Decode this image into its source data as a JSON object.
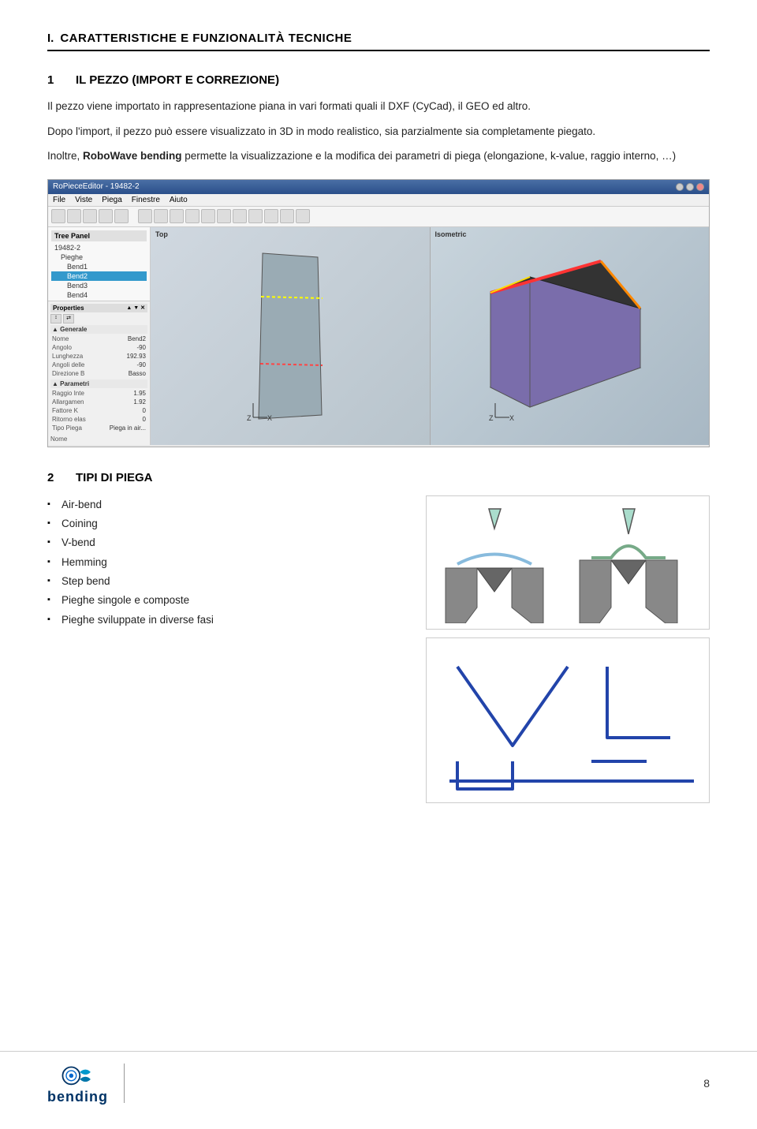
{
  "page": {
    "section_number": "I.",
    "section_title": "CARATTERISTICHE E FUNZIONALITÀ TECNICHE",
    "subsections": [
      {
        "number": "1",
        "title": "IL PEZZO (Import e Correzione)",
        "paragraphs": [
          "Il pezzo viene importato in rappresentazione piana in vari formati quali il DXF (CyCad), il GEO ed altro.",
          "Dopo l'import, il pezzo può essere visualizzato in 3D in modo realistico, sia parzialmente sia completamente piegato.",
          "Inoltre, RoboWave bending permette la visualizzazione e la modifica dei parametri di piega (elongazione, k-value, raggio interno, …)"
        ],
        "paragraph3_bold_start": "RoboWave bending"
      },
      {
        "number": "2",
        "title": "TIPI DI PIEGA",
        "bullets": [
          "Air-bend",
          "Coining",
          "V-bend",
          "Hemming",
          "Step bend",
          "Pieghe singole e composte",
          "Pieghe sviluppate in diverse fasi"
        ]
      }
    ]
  },
  "software": {
    "title": "RoPieceEditor - 19482-2",
    "menus": [
      "File",
      "Viste",
      "Piega",
      "Finestre",
      "Aiuto"
    ],
    "tree_panel_title": "Tree Panel",
    "tree_items": [
      "19482-2",
      "Pieghe",
      "Bend1",
      "Bend2",
      "Bend3",
      "Bend4"
    ],
    "viewport_left_label": "Top",
    "viewport_right_label": "Isometric",
    "properties_title": "Properties",
    "properties_items": [
      {
        "label": "Generale",
        "value": ""
      },
      {
        "label": "Nome",
        "value": "Bend2"
      },
      {
        "label": "Angolo",
        "value": "-90"
      },
      {
        "label": "Lunghezza",
        "value": "192.93"
      },
      {
        "label": "Angoli delle",
        "value": "-90"
      },
      {
        "label": "Direzione B",
        "value": "Basso"
      },
      {
        "label": "Parametri",
        "value": ""
      },
      {
        "label": "Raggio Inte",
        "value": "1.95"
      },
      {
        "label": "Allargamen",
        "value": "1.92"
      },
      {
        "label": "Fattore K",
        "value": "0"
      },
      {
        "label": "Ritorno elas",
        "value": "0"
      },
      {
        "label": "Tipo Piega",
        "value": "Piega in air..."
      }
    ]
  },
  "footer": {
    "logo_text": "bending",
    "page_number": "8"
  }
}
